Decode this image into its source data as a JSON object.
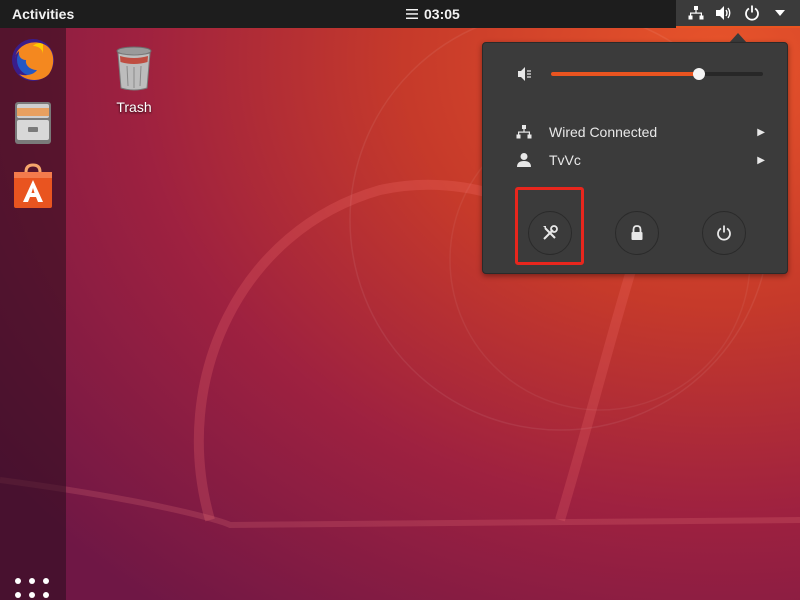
{
  "topbar": {
    "activities_label": "Activities",
    "clock_icon": "notification-lines-icon",
    "clock_time": "03:05",
    "tray_icons": [
      "network-wired-icon",
      "speaker-icon",
      "power-icon",
      "dropdown-triangle-icon"
    ]
  },
  "dock": {
    "items": [
      {
        "name": "firefox",
        "icon": "firefox-icon"
      },
      {
        "name": "files",
        "icon": "file-cabinet-icon"
      },
      {
        "name": "ubuntu-software",
        "icon": "software-bag-icon"
      }
    ],
    "show_apps_icon": "app-grid-icon"
  },
  "desktop": {
    "trash_label": "Trash"
  },
  "system_menu": {
    "volume": {
      "icon": "speaker-muted-low-icon",
      "level_percent": 70
    },
    "network": {
      "label": "Wired Connected",
      "icon": "network-wired-icon"
    },
    "user": {
      "label": "TvVc",
      "icon": "user-icon"
    },
    "buttons": [
      {
        "name": "settings",
        "icon": "settings-tools-icon"
      },
      {
        "name": "lock",
        "icon": "lock-icon"
      },
      {
        "name": "power-off",
        "icon": "power-icon"
      }
    ]
  },
  "colors": {
    "accent": "#e95420",
    "menu_bg": "#3b3b3b",
    "topbar_bg": "#1d1d1d",
    "highlight": "#e8261d"
  }
}
